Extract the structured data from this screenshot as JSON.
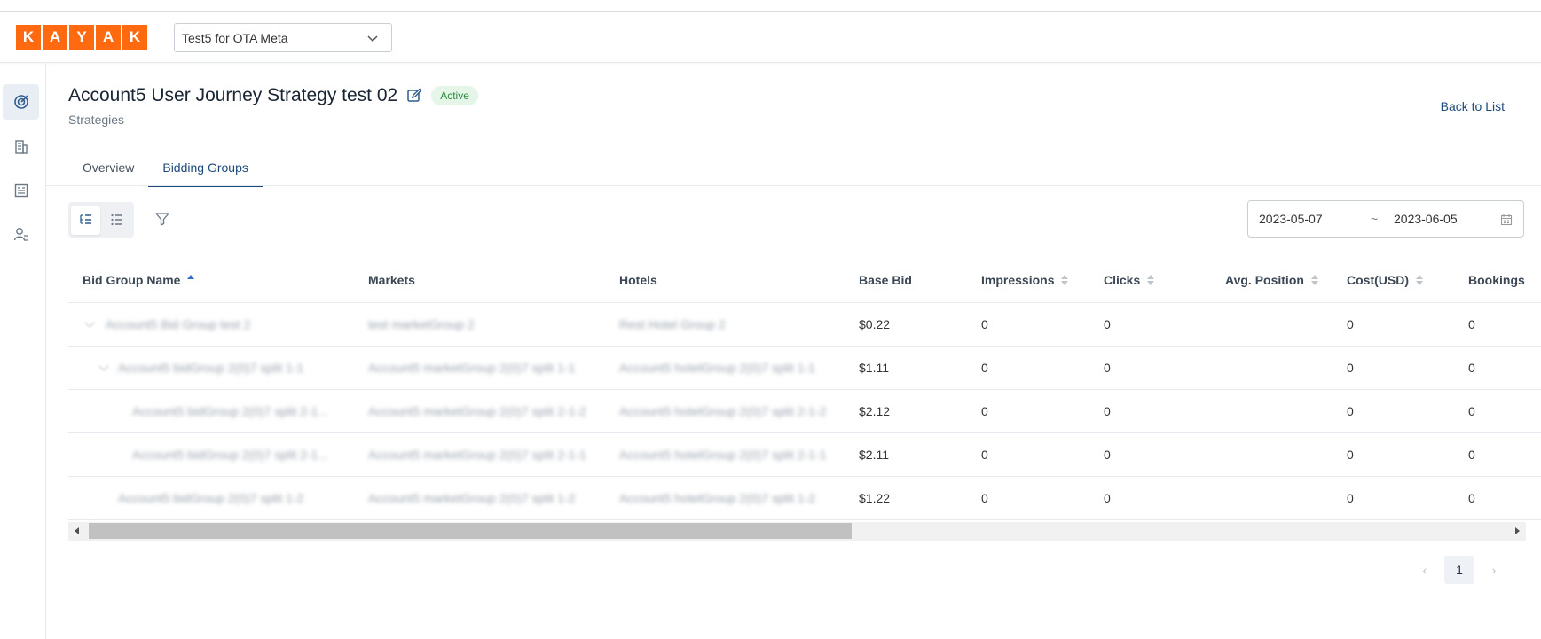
{
  "header": {
    "logo_letters": [
      "K",
      "A",
      "Y",
      "A",
      "K"
    ],
    "account_selector": "Test5 for OTA Meta"
  },
  "sidebar": {
    "items": [
      {
        "icon": "target-icon",
        "active": true
      },
      {
        "icon": "building-icon",
        "active": false
      },
      {
        "icon": "report-icon",
        "active": false
      },
      {
        "icon": "user-list-icon",
        "active": false
      }
    ]
  },
  "page": {
    "title": "Account5 User Journey Strategy test 02",
    "status": "Active",
    "breadcrumb": "Strategies",
    "back_link": "Back to List"
  },
  "tabs": [
    {
      "label": "Overview",
      "active": false
    },
    {
      "label": "Bidding Groups",
      "active": true
    }
  ],
  "toolbar": {
    "date_start": "2023-05-07",
    "date_sep": "~",
    "date_end": "2023-06-05"
  },
  "table": {
    "columns": [
      "Bid Group Name",
      "Markets",
      "Hotels",
      "Base Bid",
      "Impressions",
      "Clicks",
      "Avg. Position",
      "Cost(USD)",
      "Bookings"
    ],
    "rows": [
      {
        "name": "Account5 Bid Group test 2",
        "markets": "test marketGroup 2",
        "hotels": "Rest Hotel Group 2",
        "base_bid": "$0.22",
        "impressions": "0",
        "clicks": "0",
        "avg_position": "",
        "cost": "0",
        "bookings": "0"
      },
      {
        "name": "Account5 bidGroup 2(0)7 split 1-1",
        "markets": "Account5 marketGroup 2(0)7 split 1-1",
        "hotels": "Account5 hotelGroup 2(0)7 split 1-1",
        "base_bid": "$1.11",
        "impressions": "0",
        "clicks": "0",
        "avg_position": "",
        "cost": "0",
        "bookings": "0"
      },
      {
        "name": "Account5 bidGroup 2(0)7 split 2-1...",
        "markets": "Account5 marketGroup 2(0)7 split 2-1-2",
        "hotels": "Account5 hotelGroup 2(0)7 split 2-1-2",
        "base_bid": "$2.12",
        "impressions": "0",
        "clicks": "0",
        "avg_position": "",
        "cost": "0",
        "bookings": "0"
      },
      {
        "name": "Account5 bidGroup 2(0)7 split 2-1...",
        "markets": "Account5 marketGroup 2(0)7 split 2-1-1",
        "hotels": "Account5 hotelGroup 2(0)7 split 2-1-1",
        "base_bid": "$2.11",
        "impressions": "0",
        "clicks": "0",
        "avg_position": "",
        "cost": "0",
        "bookings": "0"
      },
      {
        "name": "Account5 bidGroup 2(0)7 split 1-2",
        "markets": "Account5 marketGroup 2(0)7 split 1-2",
        "hotels": "Account5 hotelGroup 2(0)7 split 1-2",
        "base_bid": "$1.22",
        "impressions": "0",
        "clicks": "0",
        "avg_position": "",
        "cost": "0",
        "bookings": "0"
      }
    ]
  },
  "pagination": {
    "current_page": "1",
    "prev": "‹",
    "next": "›"
  },
  "colors": {
    "brand": "#ff690f",
    "link": "#1d4a7a",
    "active_badge_bg": "#e5f5e8",
    "active_badge_text": "#2e8a3f"
  }
}
